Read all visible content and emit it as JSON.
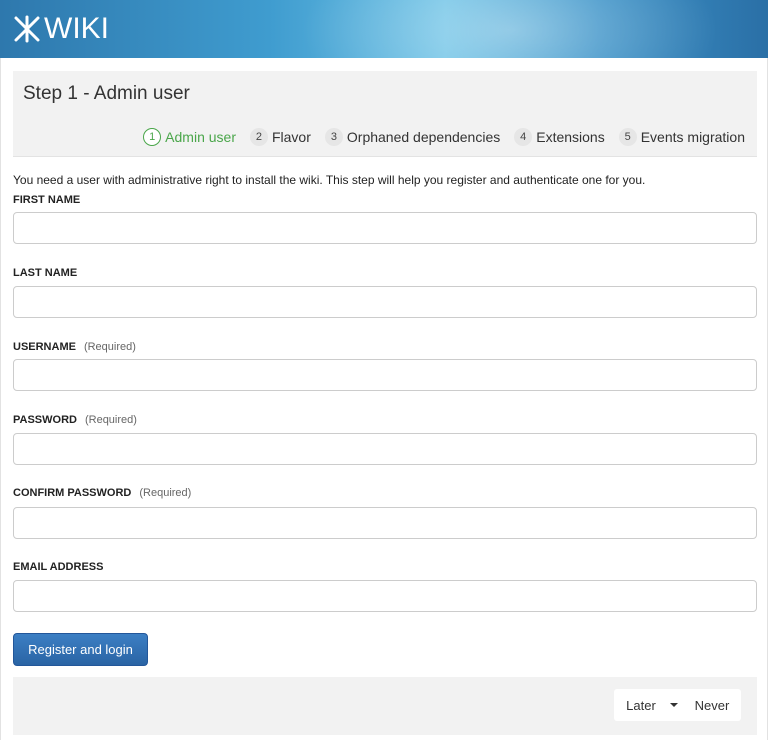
{
  "header": {
    "logo_text": "WIKI"
  },
  "step": {
    "title": "Step 1 - Admin user"
  },
  "stepper": [
    {
      "num": "1",
      "label": "Admin user",
      "active": true
    },
    {
      "num": "2",
      "label": "Flavor"
    },
    {
      "num": "3",
      "label": "Orphaned dependencies"
    },
    {
      "num": "4",
      "label": "Extensions"
    },
    {
      "num": "5",
      "label": "Events migration"
    }
  ],
  "intro": "You need a user with administrative right to install the wiki. This step will help you register and authenticate one for you.",
  "form": {
    "first_name": {
      "label": "FIRST NAME",
      "value": "",
      "required": ""
    },
    "last_name": {
      "label": "LAST NAME",
      "value": "",
      "required": ""
    },
    "username": {
      "label": "USERNAME",
      "value": "",
      "required": "(Required)"
    },
    "password": {
      "label": "PASSWORD",
      "value": "",
      "required": "(Required)"
    },
    "confirm_password": {
      "label": "CONFIRM PASSWORD",
      "value": "",
      "required": "(Required)"
    },
    "email": {
      "label": "EMAIL ADDRESS",
      "value": "",
      "required": ""
    }
  },
  "buttons": {
    "register": "Register and login",
    "later": "Later",
    "never": "Never"
  },
  "colors": {
    "accent": "#2a64a4",
    "active_step": "#4aa64a",
    "header": "#3f9ccf"
  }
}
